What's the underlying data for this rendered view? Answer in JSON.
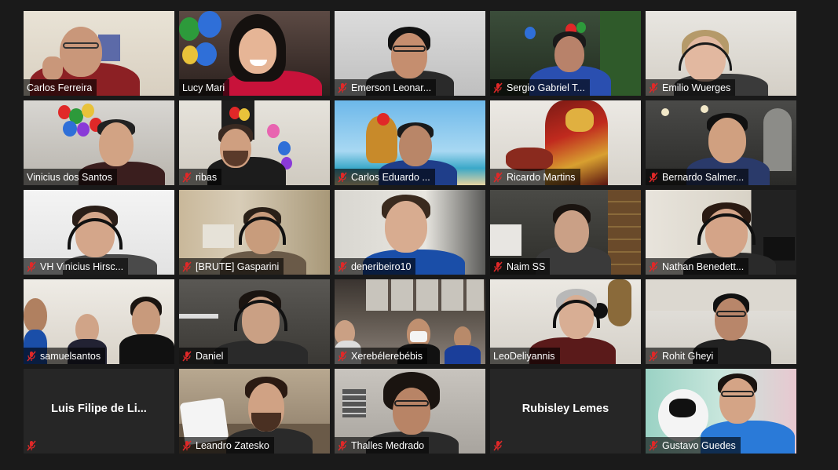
{
  "gallery": {
    "participants": [
      {
        "name": "Carlos Ferreira",
        "muted": false,
        "video": true,
        "active": true
      },
      {
        "name": "Lucy Mari",
        "muted": false,
        "video": true,
        "active": false
      },
      {
        "name": "Emerson Leonar...",
        "muted": true,
        "video": true,
        "active": false
      },
      {
        "name": "Sergio Gabriel T...",
        "muted": true,
        "video": true,
        "active": false
      },
      {
        "name": "Emilio Wuerges",
        "muted": true,
        "video": true,
        "active": false
      },
      {
        "name": "Vinicius dos Santos",
        "muted": false,
        "video": true,
        "active": false
      },
      {
        "name": "ribas",
        "muted": true,
        "video": true,
        "active": false
      },
      {
        "name": "Carlos Eduardo ...",
        "muted": true,
        "video": true,
        "active": false
      },
      {
        "name": "Ricardo Martins",
        "muted": true,
        "video": true,
        "active": false
      },
      {
        "name": "Bernardo Salmer...",
        "muted": true,
        "video": true,
        "active": false
      },
      {
        "name": "VH Vinicius Hirsc...",
        "muted": true,
        "video": true,
        "active": false
      },
      {
        "name": "[BRUTE] Gasparini",
        "muted": true,
        "video": true,
        "active": false
      },
      {
        "name": "deneribeiro10",
        "muted": true,
        "video": true,
        "active": false
      },
      {
        "name": "Naim SS",
        "muted": true,
        "video": true,
        "active": false
      },
      {
        "name": "Nathan Benedett...",
        "muted": true,
        "video": true,
        "active": false
      },
      {
        "name": "samuelsantos",
        "muted": true,
        "video": true,
        "active": false
      },
      {
        "name": "Daniel",
        "muted": true,
        "video": true,
        "active": false
      },
      {
        "name": "Xerebélerebébis",
        "muted": true,
        "video": true,
        "active": false
      },
      {
        "name": "LeoDeliyannis",
        "muted": false,
        "video": true,
        "active": false
      },
      {
        "name": "Rohit Gheyi",
        "muted": true,
        "video": true,
        "active": false
      },
      {
        "name": "Luis Filipe de Li...",
        "muted": true,
        "video": false,
        "active": false
      },
      {
        "name": "Leandro Zatesko",
        "muted": true,
        "video": true,
        "active": false
      },
      {
        "name": "Thalles Medrado",
        "muted": true,
        "video": true,
        "active": false
      },
      {
        "name": "Rubisley Lemes",
        "muted": true,
        "video": false,
        "active": false
      },
      {
        "name": "Gustavo Guedes",
        "muted": true,
        "video": true,
        "active": false
      }
    ]
  },
  "colors": {
    "background": "#1a1a1a",
    "active_speaker_border": "#c7e33a",
    "muted_icon": "#e02828"
  },
  "icons": {
    "muted": "microphone-muted-icon"
  }
}
